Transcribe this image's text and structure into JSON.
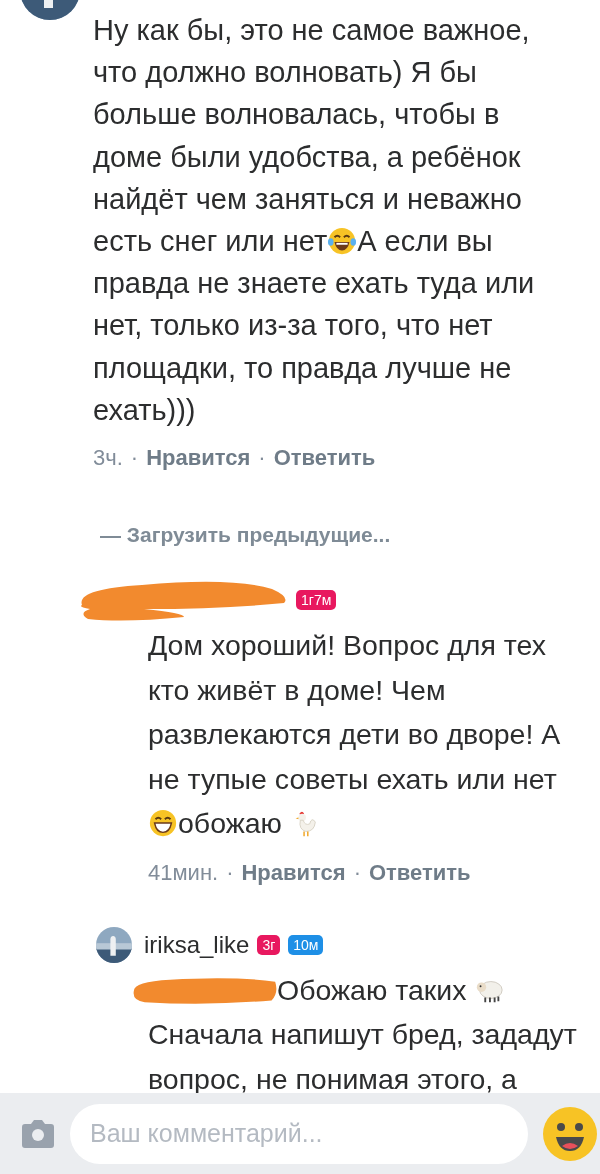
{
  "comments": [
    {
      "kind": "top",
      "body": [
        {
          "kind": "text",
          "text": "Ну как бы, это не самое важное, что должно волновать) Я бы больше волновалась, чтобы в доме были удобства, а ребёнок найдёт чем заняться и неважно есть снег или нет"
        },
        {
          "kind": "tears-of-joy"
        },
        {
          "kind": "text",
          "text": "А если вы правда не знаете ехать туда или нет, только из-за того, что нет площадки, то правда лучше не ехать)))"
        }
      ],
      "meta": [
        {
          "kind": "time",
          "text": "3ч."
        },
        {
          "kind": "sep",
          "text": "·"
        },
        {
          "kind": "link",
          "text": "Нравится"
        },
        {
          "kind": "sep",
          "text": "·"
        },
        {
          "kind": "link",
          "text": "Ответить"
        }
      ]
    },
    {
      "kind": "load-more",
      "text": "— Загрузить предыдущие..."
    },
    {
      "kind": "reply",
      "badges": [
        {
          "text": "1г7м",
          "color": "#e8185f"
        }
      ],
      "body": [
        {
          "kind": "text",
          "text": "Дом хороший! Вопрос для тех кто живёт в доме! Чем развлекаются дети во дворе! А не тупые советы ехать или нет "
        },
        {
          "kind": "grin"
        },
        {
          "kind": "text",
          "text": "обожаю "
        },
        {
          "kind": "rooster"
        }
      ],
      "meta": [
        {
          "kind": "time",
          "text": "41мин."
        },
        {
          "kind": "sep",
          "text": "·"
        },
        {
          "kind": "link",
          "text": "Нравится"
        },
        {
          "kind": "sep",
          "text": "·"
        },
        {
          "kind": "link",
          "text": "Ответить"
        }
      ]
    },
    {
      "kind": "reply",
      "author": "iriksa_like",
      "badges": [
        {
          "text": "3г",
          "color": "#e8185f"
        },
        {
          "text": "10м",
          "color": "#1e8fe6"
        }
      ],
      "body": [
        {
          "kind": "redacted"
        },
        {
          "kind": "text",
          "text": "Обожаю таких "
        },
        {
          "kind": "sheep"
        },
        {
          "kind": "text",
          "text": " Сначала напишут бред, зададут вопрос, не понимая этого, а"
        }
      ]
    }
  ],
  "composer": {
    "placeholder": "Ваш комментарий..."
  }
}
